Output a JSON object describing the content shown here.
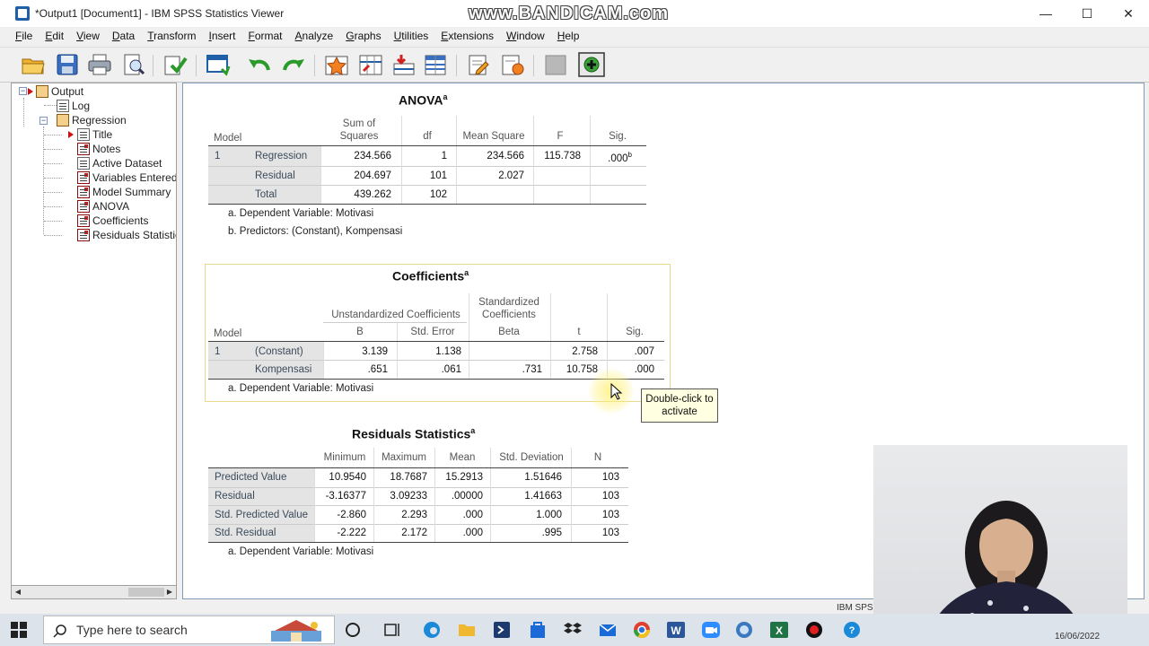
{
  "window": {
    "title": "*Output1 [Document1] - IBM SPSS Statistics Viewer",
    "watermark": "www.BANDICAM.com",
    "minimize": "—",
    "maximize": "☐",
    "close": "✕"
  },
  "menu": [
    {
      "u": "F",
      "rest": "ile"
    },
    {
      "u": "E",
      "rest": "dit"
    },
    {
      "u": "V",
      "rest": "iew"
    },
    {
      "u": "D",
      "rest": "ata"
    },
    {
      "u": "T",
      "rest": "ransform"
    },
    {
      "u": "I",
      "rest": "nsert"
    },
    {
      "u": "F",
      "rest": "ormat"
    },
    {
      "u": "A",
      "rest": "nalyze"
    },
    {
      "u": "G",
      "rest": "raphs"
    },
    {
      "u": "U",
      "rest": "tilities"
    },
    {
      "u": "E",
      "rest": "xtensions"
    },
    {
      "u": "W",
      "rest": "indow"
    },
    {
      "u": "H",
      "rest": "elp"
    }
  ],
  "toolbar": {
    "icons": [
      "open-icon",
      "save-icon",
      "print-icon",
      "print-preview-icon",
      "export-icon",
      "recall-dialog-icon",
      "undo-icon",
      "redo-icon",
      "goto-data-icon",
      "goto-variable-icon",
      "insert-cases-icon",
      "variables-icon",
      "show-outline-icon",
      "designate-window-icon",
      "hide-icon",
      "add-icon"
    ]
  },
  "outline": {
    "root": "Output",
    "log": "Log",
    "regression": "Regression",
    "children": [
      "Title",
      "Notes",
      "Active Dataset",
      "Variables Entered",
      "Model Summary",
      "ANOVA",
      "Coefficients",
      "Residuals Statistics"
    ]
  },
  "anova": {
    "title": "ANOVA",
    "sup": "a",
    "headers": {
      "model": "Model",
      "ss1": "Sum of",
      "ss2": "Squares",
      "df": "df",
      "ms": "Mean Square",
      "f": "F",
      "sig": "Sig."
    },
    "rows": [
      {
        "model": "1",
        "label": "Regression",
        "ss": "234.566",
        "df": "1",
        "ms": "234.566",
        "f": "115.738",
        "sig": ".000",
        "sig_sup": "b"
      },
      {
        "model": "",
        "label": "Residual",
        "ss": "204.697",
        "df": "101",
        "ms": "2.027",
        "f": "",
        "sig": "",
        "sig_sup": ""
      },
      {
        "model": "",
        "label": "Total",
        "ss": "439.262",
        "df": "102",
        "ms": "",
        "f": "",
        "sig": "",
        "sig_sup": ""
      }
    ],
    "notes": [
      "a. Dependent Variable: Motivasi",
      "b. Predictors: (Constant), Kompensasi"
    ]
  },
  "coefficients": {
    "title": "Coefficients",
    "sup": "a",
    "headers": {
      "model": "Model",
      "unstd": "Unstandardized Coefficients",
      "std1": "Standardized",
      "std2": "Coefficients",
      "b": "B",
      "se": "Std. Error",
      "beta": "Beta",
      "t": "t",
      "sig": "Sig."
    },
    "rows": [
      {
        "model": "1",
        "label": "(Constant)",
        "b": "3.139",
        "se": "1.138",
        "beta": "",
        "t": "2.758",
        "sig": ".007"
      },
      {
        "model": "",
        "label": "Kompensasi",
        "b": ".651",
        "se": ".061",
        "beta": ".731",
        "t": "10.758",
        "sig": ".000"
      }
    ],
    "note": "a. Dependent Variable: Motivasi"
  },
  "tooltip": {
    "line1": "Double-click to",
    "line2": "activate"
  },
  "residuals": {
    "title": "Residuals Statistics",
    "sup": "a",
    "headers": {
      "min": "Minimum",
      "max": "Maximum",
      "mean": "Mean",
      "sd": "Std. Deviation",
      "n": "N"
    },
    "rows": [
      {
        "label": "Predicted Value",
        "min": "10.9540",
        "max": "18.7687",
        "mean": "15.2913",
        "sd": "1.51646",
        "n": "103"
      },
      {
        "label": "Residual",
        "min": "-3.16377",
        "max": "3.09233",
        "mean": ".00000",
        "sd": "1.41663",
        "n": "103"
      },
      {
        "label": "Std. Predicted Value",
        "min": "-2.860",
        "max": "2.293",
        "mean": ".000",
        "sd": "1.000",
        "n": "103"
      },
      {
        "label": "Std. Residual",
        "min": "-2.222",
        "max": "2.172",
        "mean": ".000",
        "sd": ".995",
        "n": "103"
      }
    ],
    "note": "a. Dependent Variable: Motivasi"
  },
  "statusbar": {
    "text": "IBM SPS"
  },
  "taskbar": {
    "search_placeholder": "Type here to search",
    "date": "16/06/2022",
    "apps": [
      "cortana-icon",
      "task-view-icon",
      "edge-icon",
      "file-explorer-icon",
      "powershell-icon",
      "store-icon",
      "dropbox-icon",
      "mail-icon",
      "chrome-icon",
      "word-icon",
      "zoom-icon",
      "spss-icon",
      "excel-icon",
      "record-icon",
      "help-icon"
    ]
  },
  "colors": {
    "accent": "#1f5fa8",
    "tooltip_bg": "#ffffe1",
    "selection_frame": "#e8d98a",
    "shade": "#e4e4e4"
  }
}
